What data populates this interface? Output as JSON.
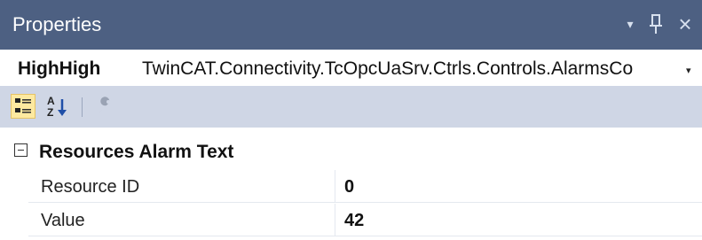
{
  "window": {
    "title": "Properties",
    "dropdown_glyph": "▾",
    "pin_glyph": "ꟼ",
    "close_glyph": "×"
  },
  "selector": {
    "object_name": "HighHigh",
    "object_type": "TwinCAT.Connectivity.TcOpcUaSrv.Ctrls.Controls.AlarmsCo",
    "arrow_glyph": "▾"
  },
  "toolbar": {
    "categorized_icon": "categorized-icon",
    "alphabetical_icon": "alphabetical-sort-icon",
    "property_pages_icon": "wrench-icon",
    "alphabetical_top": "A",
    "alphabetical_bottom": "Z",
    "alphabetical_arrow": "↓"
  },
  "grid": {
    "category": {
      "title": "Resources Alarm Text",
      "expanded": true
    },
    "rows": [
      {
        "name": "Resource ID",
        "value": "0"
      },
      {
        "name": "Value",
        "value": "42"
      }
    ]
  },
  "colors": {
    "titlebar": "#4d6082",
    "panel": "#cfd6e5",
    "categorized_button": "#fde9a0"
  }
}
